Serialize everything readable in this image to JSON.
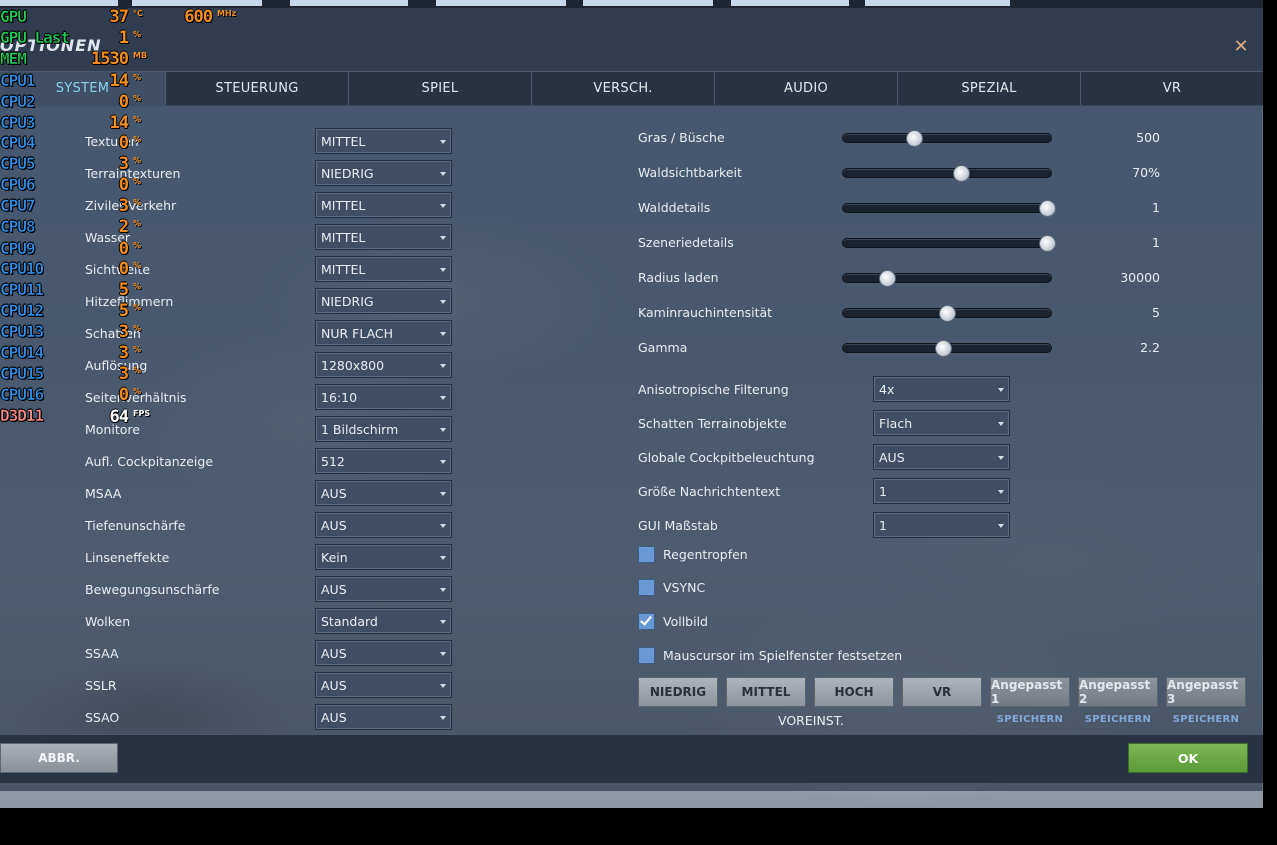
{
  "dialog": {
    "title": "OPTIONEN",
    "close_glyph": "✕"
  },
  "tabs": [
    {
      "label": "SYSTEM"
    },
    {
      "label": "STEUERUNG"
    },
    {
      "label": "SPIEL"
    },
    {
      "label": "VERSCH."
    },
    {
      "label": "AUDIO"
    },
    {
      "label": "SPEZIAL"
    },
    {
      "label": "VR"
    }
  ],
  "left_settings": [
    {
      "label": "Texturen",
      "value": "MITTEL"
    },
    {
      "label": "Terraintexturen",
      "value": "NIEDRIG"
    },
    {
      "label": "Ziviler Verkehr",
      "value": "MITTEL"
    },
    {
      "label": "Wasser",
      "value": "MITTEL"
    },
    {
      "label": "Sichtweite",
      "value": "MITTEL"
    },
    {
      "label": "Hitzeflimmern",
      "value": "NIEDRIG"
    },
    {
      "label": "Schatten",
      "value": "NUR FLACH"
    },
    {
      "label": "Auflösung",
      "value": "1280x800"
    },
    {
      "label": "Seitenverhältnis",
      "value": "16:10"
    },
    {
      "label": "Monitore",
      "value": "1 Bildschirm"
    },
    {
      "label": "Aufl. Cockpitanzeige",
      "value": "512"
    },
    {
      "label": "MSAA",
      "value": "AUS"
    },
    {
      "label": "Tiefenunschärfe",
      "value": "AUS"
    },
    {
      "label": "Linseneffekte",
      "value": "Kein"
    },
    {
      "label": "Bewegungsunschärfe",
      "value": "AUS"
    },
    {
      "label": "Wolken",
      "value": "Standard"
    },
    {
      "label": "SSAA",
      "value": "AUS"
    },
    {
      "label": "SSLR",
      "value": "AUS"
    },
    {
      "label": "SSAO",
      "value": "AUS"
    }
  ],
  "sliders": [
    {
      "label": "Gras / Büsche",
      "value": "500",
      "position": 0.34
    },
    {
      "label": "Waldsichtbarkeit",
      "value": "70%",
      "position": 0.565
    },
    {
      "label": "Walddetails",
      "value": "1",
      "position": 0.98
    },
    {
      "label": "Szeneriedetails",
      "value": "1",
      "position": 0.98
    },
    {
      "label": "Radius laden",
      "value": "30000",
      "position": 0.21
    },
    {
      "label": "Kaminrauchintensität",
      "value": "5",
      "position": 0.5
    },
    {
      "label": "Gamma",
      "value": "2.2",
      "position": 0.48
    }
  ],
  "right_settings": [
    {
      "label": "Anisotropische Filterung",
      "value": "4x"
    },
    {
      "label": "Schatten Terrainobjekte",
      "value": "Flach"
    },
    {
      "label": "Globale Cockpitbeleuchtung",
      "value": "AUS"
    },
    {
      "label": "Größe Nachrichtentext",
      "value": "1"
    },
    {
      "label": "GUI Maßstab",
      "value": "1"
    }
  ],
  "checkboxes": [
    {
      "label": "Regentropfen",
      "checked": false
    },
    {
      "label": "VSYNC",
      "checked": false
    },
    {
      "label": "Vollbild",
      "checked": true
    },
    {
      "label": "Mauscursor im Spielfenster festsetzen",
      "checked": false
    }
  ],
  "presets": {
    "buttons": [
      "NIEDRIG",
      "MITTEL",
      "HOCH",
      "VR"
    ],
    "custom": [
      "Angepasst 1",
      "Angepasst 2",
      "Angepasst 3"
    ],
    "save_label": "SPEICHERN",
    "caption": "VOREINST."
  },
  "footer": {
    "cancel_label": "ABBR.",
    "ok_label": "OK"
  },
  "overlay": {
    "rows": [
      {
        "label": "GPU",
        "value": "37",
        "unit": "°C",
        "extra_value": "600",
        "extra_unit": "MHz",
        "color": "#1fcf5a"
      },
      {
        "label": "GPU Last",
        "value": "1",
        "unit": "%",
        "color": "#1fcf5a"
      },
      {
        "label": "MEM",
        "value": "1530",
        "unit": "MB",
        "color": "#1fcf5a"
      },
      {
        "label": "CPU1",
        "value": "14",
        "unit": "%",
        "color": "#2f8ee8"
      },
      {
        "label": "CPU2",
        "value": "0",
        "unit": "%",
        "color": "#2f8ee8"
      },
      {
        "label": "CPU3",
        "value": "14",
        "unit": "%",
        "color": "#2f8ee8"
      },
      {
        "label": "CPU4",
        "value": "0",
        "unit": "%",
        "color": "#2f8ee8"
      },
      {
        "label": "CPU5",
        "value": "3",
        "unit": "%",
        "color": "#2f8ee8"
      },
      {
        "label": "CPU6",
        "value": "0",
        "unit": "%",
        "color": "#2f8ee8"
      },
      {
        "label": "CPU7",
        "value": "3",
        "unit": "%",
        "color": "#2f8ee8"
      },
      {
        "label": "CPU8",
        "value": "2",
        "unit": "%",
        "color": "#2f8ee8"
      },
      {
        "label": "CPU9",
        "value": "0",
        "unit": "%",
        "color": "#2f8ee8"
      },
      {
        "label": "CPU10",
        "value": "0",
        "unit": "%",
        "color": "#2f8ee8"
      },
      {
        "label": "CPU11",
        "value": "5",
        "unit": "%",
        "color": "#2f8ee8"
      },
      {
        "label": "CPU12",
        "value": "5",
        "unit": "%",
        "color": "#2f8ee8"
      },
      {
        "label": "CPU13",
        "value": "3",
        "unit": "%",
        "color": "#2f8ee8"
      },
      {
        "label": "CPU14",
        "value": "3",
        "unit": "%",
        "color": "#2f8ee8"
      },
      {
        "label": "CPU15",
        "value": "3",
        "unit": "%",
        "color": "#2f8ee8"
      },
      {
        "label": "CPU16",
        "value": "0",
        "unit": "%",
        "color": "#2f8ee8"
      },
      {
        "label": "D3D11",
        "value": "64",
        "unit": "FPS",
        "color": "#ff8a8a"
      }
    ]
  },
  "colors": {
    "accent_tab": "#8fd2ef",
    "ok": "#5a9a38",
    "checkbox": "#6a98d4",
    "osd_value": "#f28c1c"
  }
}
